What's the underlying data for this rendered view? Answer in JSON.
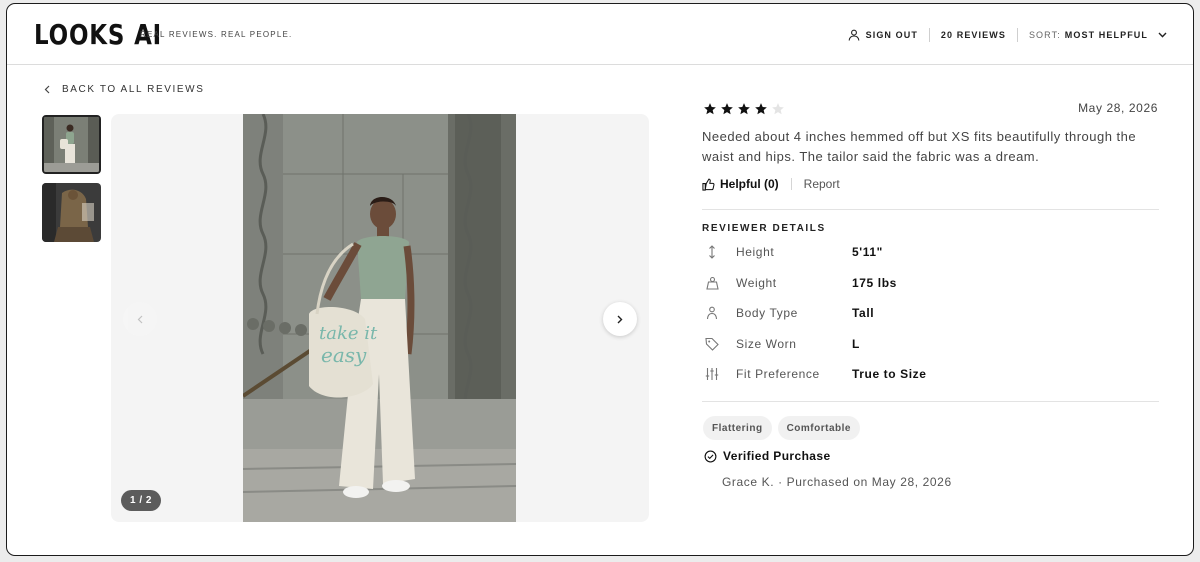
{
  "header": {
    "logo": "LOOKS AI",
    "tagline": "REAL REVIEWS. REAL PEOPLE.",
    "sign_out_icon": "user-icon",
    "sign_out_label": "SIGN OUT",
    "reviews_count_label": "20 REVIEWS",
    "sort_prefix": "SORT:",
    "sort_value": "MOST HELPFUL"
  },
  "back_link": {
    "label": "BACK TO ALL REVIEWS",
    "icon": "chevron-left-icon"
  },
  "gallery": {
    "thumbnails": [
      "photo-1",
      "photo-2"
    ],
    "selected_index": 1,
    "counter": "1 / 2"
  },
  "review": {
    "rating": 4,
    "rating_max": 5,
    "date": "May 28, 2026",
    "text": "Needed about 4 inches hemmed off but XS fits beautifully through the waist and hips. The tailor said the fabric was a dream.",
    "helpful_label": "Helpful (0)",
    "report_label": "Report"
  },
  "reviewer_details": {
    "title": "REVIEWER DETAILS",
    "rows": [
      {
        "icon": "height-arrows-icon",
        "label": "Height",
        "value": "5'11\""
      },
      {
        "icon": "weight-icon",
        "label": "Weight",
        "value": "175 lbs"
      },
      {
        "icon": "person-icon",
        "label": "Body Type",
        "value": "Tall"
      },
      {
        "icon": "tag-icon",
        "label": "Size Worn",
        "value": "L"
      },
      {
        "icon": "sliders-icon",
        "label": "Fit Preference",
        "value": "True to Size"
      }
    ]
  },
  "tags": [
    "Flattering",
    "Comfortable"
  ],
  "verified": {
    "label": "Verified Purchase",
    "purchaser": "Grace K. · Purchased on May 28, 2026"
  },
  "colors": {
    "border": "#1c1c1c",
    "accent": "#111111",
    "muted": "#555555",
    "chip_bg": "#f1f1f1"
  }
}
